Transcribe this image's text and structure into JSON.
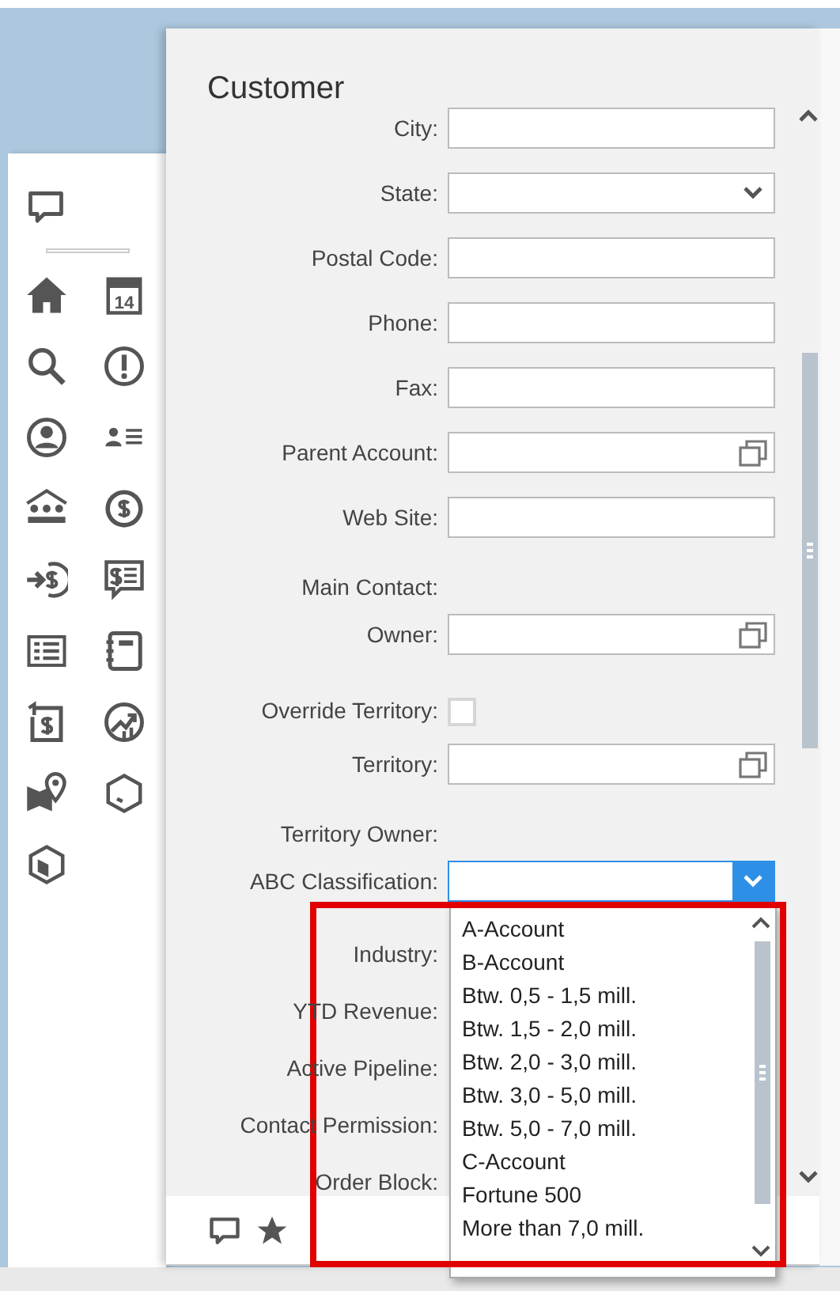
{
  "sidebar": {
    "items": [
      {
        "kind": "home"
      },
      {
        "kind": "calendar",
        "label": "14"
      },
      {
        "kind": "search"
      },
      {
        "kind": "alert"
      },
      {
        "kind": "user"
      },
      {
        "kind": "contacts"
      },
      {
        "kind": "accounts"
      },
      {
        "kind": "dollar"
      },
      {
        "kind": "transfer"
      },
      {
        "kind": "quote"
      },
      {
        "kind": "list"
      },
      {
        "kind": "notebook"
      },
      {
        "kind": "invoice"
      },
      {
        "kind": "growth"
      },
      {
        "kind": "map"
      },
      {
        "kind": "box"
      },
      {
        "kind": "package"
      }
    ]
  },
  "panel": {
    "title": "Customer",
    "fields": [
      {
        "label": "City:",
        "kind": "text"
      },
      {
        "label": "State:",
        "kind": "select"
      },
      {
        "label": "Postal Code:",
        "kind": "text"
      },
      {
        "label": "Phone:",
        "kind": "text"
      },
      {
        "label": "Fax:",
        "kind": "text"
      },
      {
        "label": "Parent Account:",
        "kind": "lookup"
      },
      {
        "label": "Web Site:",
        "kind": "text"
      },
      {
        "label": "Main Contact:",
        "kind": "none"
      },
      {
        "label": "Owner:",
        "kind": "lookup"
      },
      {
        "label": "Override Territory:",
        "kind": "checkbox",
        "checked": false
      },
      {
        "label": "Territory:",
        "kind": "lookup"
      },
      {
        "label": "Territory Owner:",
        "kind": "none"
      },
      {
        "label": "ABC Classification:",
        "kind": "select",
        "focused": true
      },
      {
        "label": "Industry:",
        "kind": "covered"
      },
      {
        "label": "YTD Revenue:",
        "kind": "covered"
      },
      {
        "label": "Active Pipeline:",
        "kind": "covered"
      },
      {
        "label": "Contact Permission:",
        "kind": "covered"
      },
      {
        "label": "Order Block:",
        "kind": "covered"
      }
    ]
  },
  "dropdown": {
    "options": [
      "A-Account",
      "B-Account",
      "Btw. 0,5 - 1,5 mill.",
      "Btw. 1,5 - 2,0 mill.",
      "Btw. 2,0 - 3,0 mill.",
      "Btw. 3,0 - 5,0 mill.",
      "Btw. 5,0 - 7,0 mill.",
      "C-Account",
      "Fortune 500",
      "More than 7,0 mill."
    ]
  },
  "annotation": {
    "kind": "highlight-box",
    "color": "#e00000"
  }
}
